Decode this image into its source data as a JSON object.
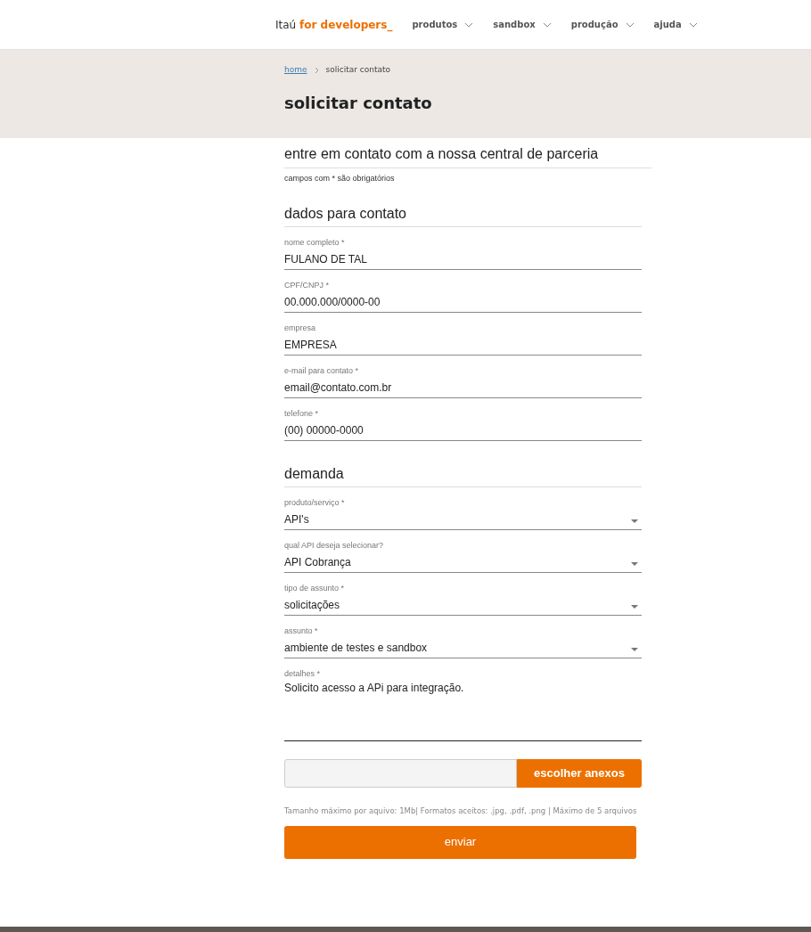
{
  "header": {
    "brand": "Itaú",
    "brand_accent": "for developers_",
    "nav": [
      {
        "label": "produtos"
      },
      {
        "label": "sandbox"
      },
      {
        "label": "produção"
      },
      {
        "label": "ajuda"
      }
    ]
  },
  "breadcrumb": [
    {
      "label": "home",
      "kind": "link"
    },
    {
      "label": "solicitar contato",
      "kind": "current"
    }
  ],
  "page_title": "solicitar contato",
  "intro": {
    "heading": "entre em contato com a nossa central de parceria",
    "note": "campos com * são obrigatórios"
  },
  "sections": [
    {
      "heading": "dados para contato",
      "fields": [
        {
          "kind": "text",
          "label": "nome completo *",
          "value": "FULANO DE TAL"
        },
        {
          "kind": "text",
          "label": "CPF/CNPJ *",
          "value": "00.000.000/0000-00"
        },
        {
          "kind": "text",
          "label": "empresa",
          "value": "EMPRESA"
        },
        {
          "kind": "text",
          "label": "e-mail para contato *",
          "value": "email@contato.com.br"
        },
        {
          "kind": "text",
          "label": "telefone *",
          "value": "(00) 00000-0000"
        }
      ]
    },
    {
      "heading": "demanda",
      "fields": [
        {
          "kind": "select",
          "label": "produto/serviço *",
          "value": "API's"
        },
        {
          "kind": "select",
          "label": "qual API deseja selecionar?",
          "value": "API Cobrança"
        },
        {
          "kind": "select",
          "label": "tipo de assunto *",
          "value": "solicitações"
        },
        {
          "kind": "select",
          "label": "assunto *",
          "value": "ambiente de testes e sandbox"
        },
        {
          "kind": "textarea",
          "label": "detalhes *",
          "value": "Solicito acesso a APi para integração."
        }
      ]
    }
  ],
  "attachments": {
    "button": "escolher anexos",
    "hint": "Tamanho máximo por aquivo: 1Mb| Formatos aceitos: .jpg, .pdf, .png | Máximo de 5 arquivos"
  },
  "submit": "enviar"
}
